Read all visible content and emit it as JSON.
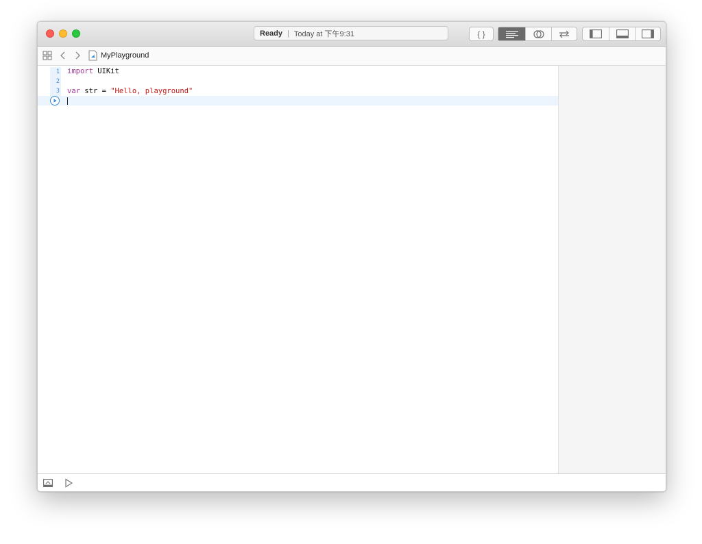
{
  "titlebar": {
    "status_state": "Ready",
    "status_time": "Today at 下午9:31"
  },
  "toolbar": {
    "editor_group": [
      {
        "name": "standard-editor",
        "icon": "curly-braces-icon",
        "label": "{ }"
      }
    ],
    "assistant_group": [
      {
        "name": "standard-editor-mode",
        "icon": "lines-icon",
        "active": true
      },
      {
        "name": "assistant-editor-mode",
        "icon": "venn-circles-icon",
        "active": false
      },
      {
        "name": "version-editor-mode",
        "icon": "arrows-swap-icon",
        "active": false
      }
    ],
    "view_group": [
      {
        "name": "navigator-toggle",
        "icon": "left-panel-icon"
      },
      {
        "name": "debug-area-toggle",
        "icon": "bottom-panel-icon"
      },
      {
        "name": "inspector-toggle",
        "icon": "right-panel-icon"
      }
    ]
  },
  "jumpbar": {
    "file_name": "MyPlayground"
  },
  "editor": {
    "line_numbers": [
      "1",
      "2",
      "3"
    ],
    "lines": [
      {
        "keyword": "import",
        "rest": " UIKit"
      },
      {
        "keyword": "",
        "rest": ""
      },
      {
        "keyword": "var",
        "rest": " str = ",
        "string": "\"Hello, playground\""
      }
    ]
  },
  "colors": {
    "accent": "#3a8ad6",
    "keyword": "#a23a97",
    "string": "#c41a16",
    "active_segment": "#6b6b6b"
  }
}
